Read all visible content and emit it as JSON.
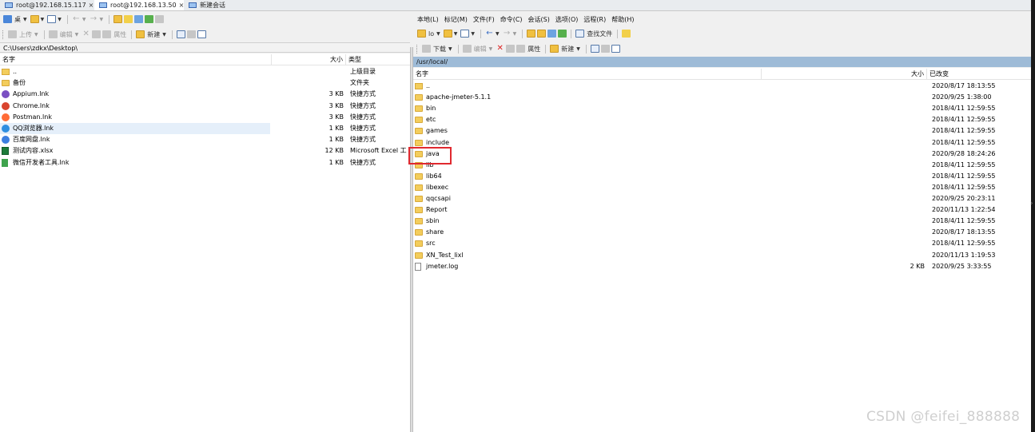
{
  "tabs": [
    {
      "label": "root@192.168.15.117",
      "close": "×"
    },
    {
      "label": "root@192.168.13.50",
      "close": "×"
    },
    {
      "label": "新建会话",
      "close": ""
    }
  ],
  "left_toolbar1": {
    "back": "←",
    "forward": "→"
  },
  "left_toolbar2": {
    "upload": "上传",
    "edit": "编辑",
    "properties": "属性",
    "new": "新建",
    "delete": "✕"
  },
  "left_path": "C:\\Users\\zdkx\\Desktop\\",
  "left_columns": {
    "name": "名字",
    "size": "大小",
    "type": "类型"
  },
  "left_files": [
    {
      "name": "..",
      "size": "",
      "type": "上级目录",
      "icon": "up"
    },
    {
      "name": "备份",
      "size": "",
      "type": "文件夹",
      "icon": "folder"
    },
    {
      "name": "Appium.lnk",
      "size": "3 KB",
      "type": "快捷方式",
      "icon": "appium"
    },
    {
      "name": "Chrome.lnk",
      "size": "3 KB",
      "type": "快捷方式",
      "icon": "chrome"
    },
    {
      "name": "Postman.lnk",
      "size": "3 KB",
      "type": "快捷方式",
      "icon": "postman"
    },
    {
      "name": "QQ浏览器.lnk",
      "size": "1 KB",
      "type": "快捷方式",
      "icon": "qqbrowser"
    },
    {
      "name": "百度网盘.lnk",
      "size": "1 KB",
      "type": "快捷方式",
      "icon": "baidu"
    },
    {
      "name": "测试内容.xlsx",
      "size": "12 KB",
      "type": "Microsoft Excel 工",
      "icon": "excel"
    },
    {
      "name": "微信开发者工具.lnk",
      "size": "1 KB",
      "type": "快捷方式",
      "icon": "wechat"
    }
  ],
  "right_menu": [
    "本地(L)",
    "标记(M)",
    "文件(F)",
    "命令(C)",
    "会话(S)",
    "选项(O)",
    "远程(R)",
    "帮助(H)"
  ],
  "right_toolbar1": {
    "location": "lo",
    "find": "查找文件",
    "back": "←",
    "forward": "→"
  },
  "right_toolbar2": {
    "download": "下载",
    "edit": "编辑",
    "properties": "属性",
    "new": "新建",
    "delete": "✕"
  },
  "right_path": "/usr/local/",
  "right_columns": {
    "name": "名字",
    "size": "大小",
    "modified": "已改变"
  },
  "right_files": [
    {
      "name": "..",
      "size": "",
      "modified": "2020/8/17 18:13:55",
      "icon": "up"
    },
    {
      "name": "apache-jmeter-5.1.1",
      "size": "",
      "modified": "2020/9/25 1:38:00",
      "icon": "folder"
    },
    {
      "name": "bin",
      "size": "",
      "modified": "2018/4/11 12:59:55",
      "icon": "folder"
    },
    {
      "name": "etc",
      "size": "",
      "modified": "2018/4/11 12:59:55",
      "icon": "folder"
    },
    {
      "name": "games",
      "size": "",
      "modified": "2018/4/11 12:59:55",
      "icon": "folder"
    },
    {
      "name": "include",
      "size": "",
      "modified": "2018/4/11 12:59:55",
      "icon": "folder"
    },
    {
      "name": "java",
      "size": "",
      "modified": "2020/9/28 18:24:26",
      "icon": "folder"
    },
    {
      "name": "lib",
      "size": "",
      "modified": "2018/4/11 12:59:55",
      "icon": "folder"
    },
    {
      "name": "lib64",
      "size": "",
      "modified": "2018/4/11 12:59:55",
      "icon": "folder"
    },
    {
      "name": "libexec",
      "size": "",
      "modified": "2018/4/11 12:59:55",
      "icon": "folder"
    },
    {
      "name": "qqcsapi",
      "size": "",
      "modified": "2020/9/25 20:23:11",
      "icon": "folder"
    },
    {
      "name": "Report",
      "size": "",
      "modified": "2020/11/13 1:22:54",
      "icon": "folder"
    },
    {
      "name": "sbin",
      "size": "",
      "modified": "2018/4/11 12:59:55",
      "icon": "folder"
    },
    {
      "name": "share",
      "size": "",
      "modified": "2020/8/17 18:13:55",
      "icon": "folder"
    },
    {
      "name": "src",
      "size": "",
      "modified": "2018/4/11 12:59:55",
      "icon": "folder"
    },
    {
      "name": "XN_Test_lixl",
      "size": "",
      "modified": "2020/11/13 1:19:53",
      "icon": "folder"
    },
    {
      "name": "jmeter.log",
      "size": "2 KB",
      "modified": "2020/9/25 3:33:55",
      "icon": "file"
    }
  ],
  "watermark": "CSDN @feifei_888888",
  "colors": {
    "path_bar_right": "#9ebbd7",
    "highlight_box": "#e0292f",
    "folder": "#f3cd5c"
  }
}
